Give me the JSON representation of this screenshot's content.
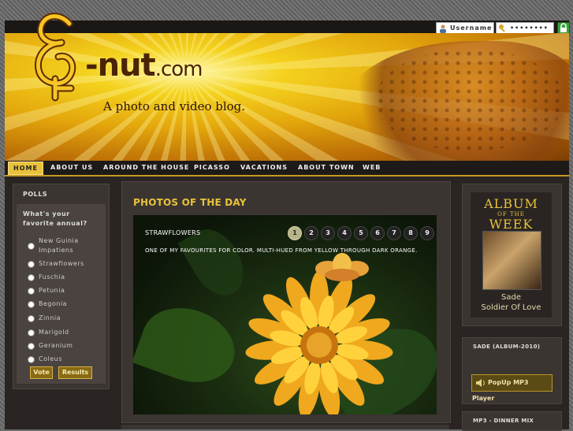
{
  "login": {
    "username_placeholder": "Username",
    "password_placeholder": "••••••••"
  },
  "header": {
    "logo_name": "-nut",
    "logo_domain": ".com",
    "tagline": "A photo and video blog."
  },
  "nav": {
    "items": [
      {
        "label": "HOME"
      },
      {
        "label": "ABOUT US"
      },
      {
        "label": "AROUND THE HOUSE"
      },
      {
        "label": "PICASSO"
      },
      {
        "label": "VACATIONS"
      },
      {
        "label": "ABOUT TOWN"
      },
      {
        "label": "WEB"
      }
    ]
  },
  "poll": {
    "title": "POLLS",
    "question": "What's your favorite annual?",
    "options": [
      {
        "label": "New Guinia Impatiens"
      },
      {
        "label": "Strawflowers"
      },
      {
        "label": "Fuschia"
      },
      {
        "label": "Petunia"
      },
      {
        "label": "Begonia"
      },
      {
        "label": "Zinnia"
      },
      {
        "label": "Marigold"
      },
      {
        "label": "Geranium"
      },
      {
        "label": "Coleus"
      }
    ],
    "vote_label": "Vote",
    "results_label": "Results"
  },
  "main": {
    "title": "PHOTOS OF THE DAY",
    "slide_title": "STRAWFLOWERS",
    "slide_caption": "ONE OF MY FAVOURITES FOR COLOR. MULTI-HUED FROM YELLOW THROUGH DARK ORANGE.",
    "pager": [
      "1",
      "2",
      "3",
      "4",
      "5",
      "6",
      "7",
      "8",
      "9"
    ],
    "active_page": "1"
  },
  "album": {
    "head_top": "ALBUM",
    "head_mid": "OF THE",
    "head_bottom": "WEEK",
    "artist": "Sade",
    "album_name": "Soldier Of Love"
  },
  "sade": {
    "title": "SADE (ALBUM-2010)",
    "popup_label": "PopUp MP3 Player"
  },
  "dinner": {
    "title": "MP3 - DINNER MIX"
  },
  "colors": {
    "accent": "#e8c23a",
    "panel": "#3b3532",
    "background": "#2a2523"
  }
}
